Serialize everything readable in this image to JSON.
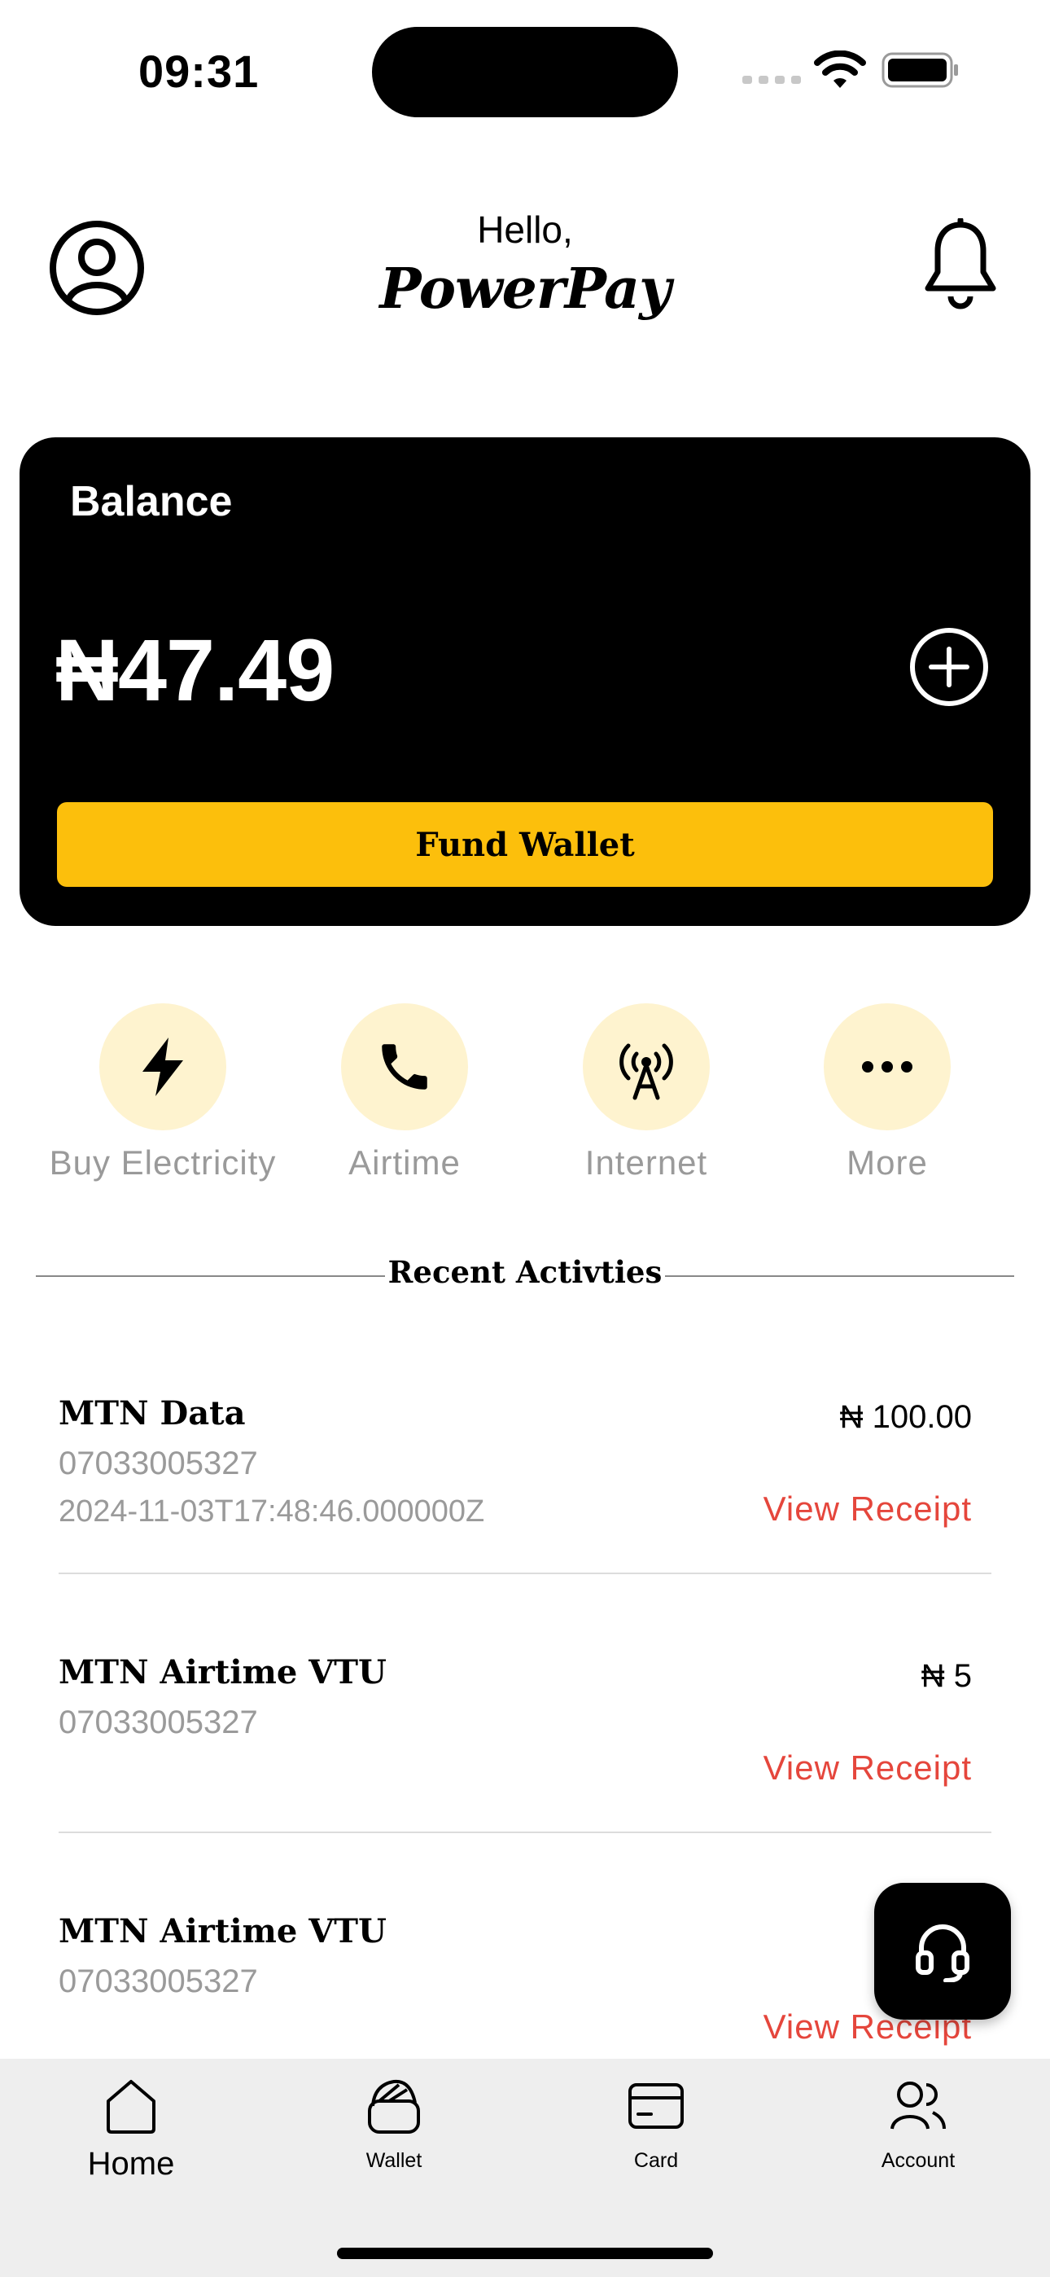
{
  "status_bar": {
    "time": "09:31"
  },
  "header": {
    "greeting": "Hello,",
    "brand": "PowerPay"
  },
  "balance": {
    "label": "Balance",
    "amount": "₦47.49",
    "fund_button": "Fund Wallet"
  },
  "quick_actions": [
    {
      "label": "Buy Electricity",
      "icon": "lightning-icon"
    },
    {
      "label": "Airtime",
      "icon": "phone-icon"
    },
    {
      "label": "Internet",
      "icon": "antenna-icon"
    },
    {
      "label": "More",
      "icon": "more-icon"
    }
  ],
  "recent": {
    "title": "Recent Activties",
    "items": [
      {
        "title": "MTN Data",
        "phone": "07033005327",
        "date": "2024-11-03T17:48:46.000000Z",
        "amount": "₦ 100.00",
        "link": "View Receipt"
      },
      {
        "title": "MTN Airtime VTU",
        "phone": "07033005327",
        "amount": "₦ 5",
        "link": "View Receipt"
      },
      {
        "title": "MTN Airtime VTU",
        "phone": "07033005327",
        "link": "View Receipt"
      }
    ]
  },
  "nav": [
    {
      "label": "Home",
      "icon": "home-icon"
    },
    {
      "label": "Wallet",
      "icon": "wallet-icon"
    },
    {
      "label": "Card",
      "icon": "card-icon"
    },
    {
      "label": "Account",
      "icon": "account-icon"
    }
  ],
  "colors": {
    "accent": "#FCBF0C",
    "action_bg": "#FEF3CF",
    "link": "#E5463C",
    "nav_bg": "#EEEEEE"
  }
}
